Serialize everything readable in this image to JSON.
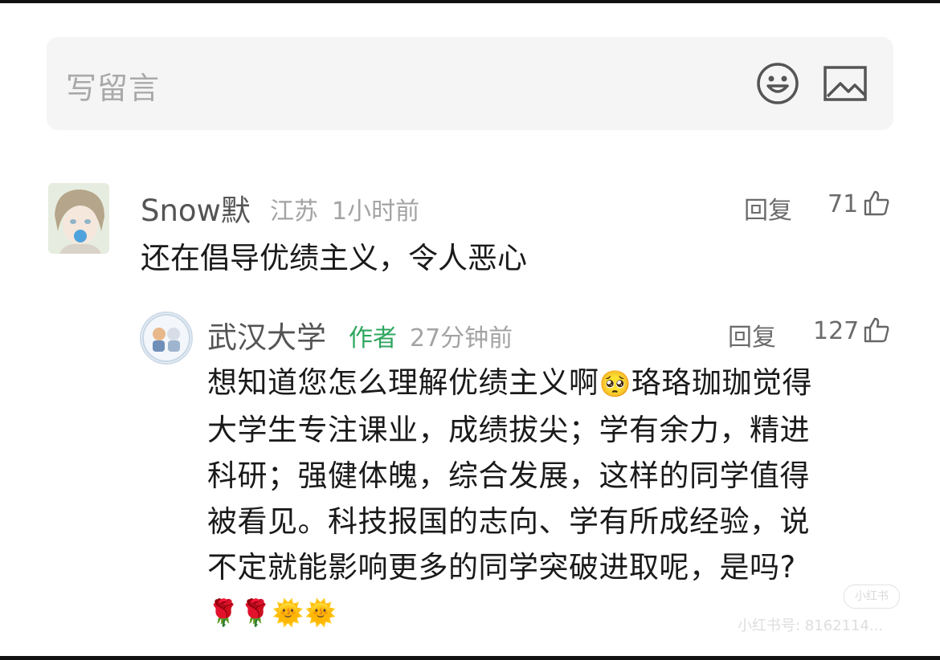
{
  "input": {
    "placeholder": "写留言"
  },
  "comment": {
    "username": "Snow默",
    "location": "江苏",
    "time": "1小时前",
    "reply_label": "回复",
    "likes": "71",
    "text": "还在倡导优绩主义，令人恶心"
  },
  "reply": {
    "username": "武汉大学",
    "author_tag": "作者",
    "time": "27分钟前",
    "reply_label": "回复",
    "likes": "127",
    "lines": [
      "想知道您怎么理解优绩主义啊",
      "珞珞珈珈觉得",
      "大学生专注课业，成绩拔尖；学有余力，精进",
      "科研；强健体魄，综合发展，这样的同学值得",
      "被看见。科技报国的志向、学有所成经验，说",
      "不定就能影响更多的同学突破进取呢，是吗?"
    ],
    "emoji_inline": "🥺",
    "emoji_trail": "🌹🌹🌞🌞"
  },
  "watermark": {
    "pill": "小红书",
    "text": "小红书号: 8162114..."
  },
  "colors": {
    "author_green": "#2ea65f",
    "meta_gray": "#a3a3a3",
    "input_bg": "#f5f5f5"
  }
}
